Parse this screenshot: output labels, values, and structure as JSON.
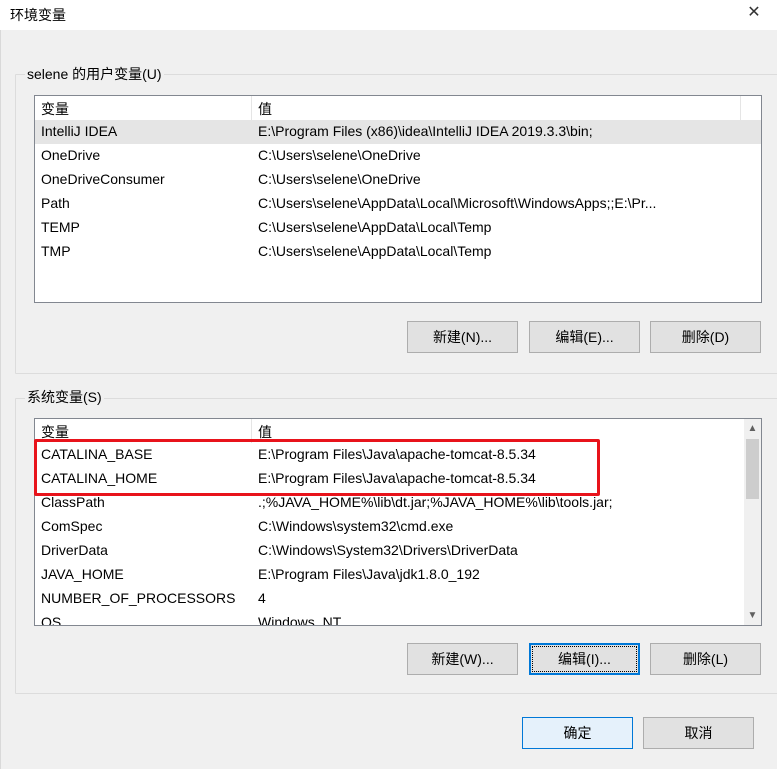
{
  "window": {
    "title": "环境变量",
    "close_glyph": "✕"
  },
  "user_vars": {
    "group_label": "selene 的用户变量(U)",
    "columns": [
      "变量",
      "值"
    ],
    "rows": [
      {
        "name": "IntelliJ IDEA",
        "value": "E:\\Program Files (x86)\\idea\\IntelliJ IDEA 2019.3.3\\bin;",
        "selected": true
      },
      {
        "name": "OneDrive",
        "value": "C:\\Users\\selene\\OneDrive"
      },
      {
        "name": "OneDriveConsumer",
        "value": "C:\\Users\\selene\\OneDrive"
      },
      {
        "name": "Path",
        "value": "C:\\Users\\selene\\AppData\\Local\\Microsoft\\WindowsApps;;E:\\Pr..."
      },
      {
        "name": "TEMP",
        "value": "C:\\Users\\selene\\AppData\\Local\\Temp"
      },
      {
        "name": "TMP",
        "value": "C:\\Users\\selene\\AppData\\Local\\Temp"
      }
    ],
    "buttons": {
      "new": "新建(N)...",
      "edit": "编辑(E)...",
      "delete": "删除(D)"
    }
  },
  "system_vars": {
    "group_label": "系统变量(S)",
    "columns": [
      "变量",
      "值"
    ],
    "rows": [
      {
        "name": "CATALINA_BASE",
        "value": "E:\\Program Files\\Java\\apache-tomcat-8.5.34"
      },
      {
        "name": "CATALINA_HOME",
        "value": "E:\\Program Files\\Java\\apache-tomcat-8.5.34"
      },
      {
        "name": "ClassPath",
        "value": ".;%JAVA_HOME%\\lib\\dt.jar;%JAVA_HOME%\\lib\\tools.jar;"
      },
      {
        "name": "ComSpec",
        "value": "C:\\Windows\\system32\\cmd.exe"
      },
      {
        "name": "DriverData",
        "value": "C:\\Windows\\System32\\Drivers\\DriverData"
      },
      {
        "name": "JAVA_HOME",
        "value": "E:\\Program Files\\Java\\jdk1.8.0_192"
      },
      {
        "name": "NUMBER_OF_PROCESSORS",
        "value": "4"
      },
      {
        "name": "OS",
        "value": "Windows_NT"
      }
    ],
    "buttons": {
      "new": "新建(W)...",
      "edit": "编辑(I)...",
      "delete": "删除(L)"
    },
    "scroll": {
      "up_glyph": "▲",
      "down_glyph": "▼"
    }
  },
  "dialog_buttons": {
    "ok": "确定",
    "cancel": "取消"
  },
  "colors": {
    "highlight": "#e8131b",
    "focus": "#0078d7"
  }
}
